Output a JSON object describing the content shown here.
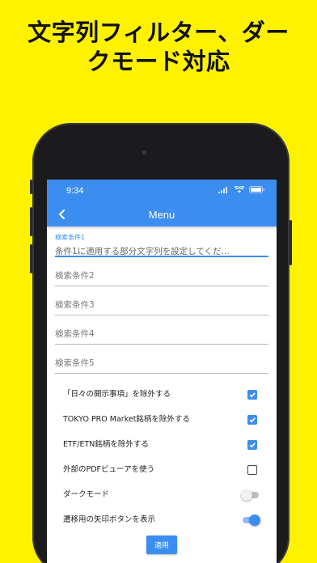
{
  "headline": {
    "line1": "文字列フィルター、ダー",
    "line2": "クモード対応"
  },
  "status": {
    "time": "9:34"
  },
  "appbar": {
    "title": "Menu"
  },
  "fields": {
    "condition1": {
      "label": "検索条件1",
      "placeholder": "条件1に適用する部分文字列を設定してくだ…"
    },
    "condition2": {
      "placeholder": "検索条件2"
    },
    "condition3": {
      "placeholder": "検索条件3"
    },
    "condition4": {
      "placeholder": "検索条件4"
    },
    "condition5": {
      "placeholder": "検索条件5"
    }
  },
  "options": [
    {
      "label": "「日々の開示事項」を除外する",
      "control": "checkbox",
      "checked": true
    },
    {
      "label": "TOKYO PRO Market銘柄を除外する",
      "control": "checkbox",
      "checked": true
    },
    {
      "label": "ETF/ETN銘柄を除外する",
      "control": "checkbox",
      "checked": true
    },
    {
      "label": "外部のPDFビューアを使う",
      "control": "checkbox",
      "checked": false
    },
    {
      "label": "ダークモード",
      "control": "switch",
      "checked": false
    },
    {
      "label": "遷移用の矢印ボタンを表示",
      "control": "switch",
      "checked": true
    }
  ],
  "apply_label": "適用",
  "colors": {
    "background": "#fff200",
    "accent": "#3b8df0"
  }
}
